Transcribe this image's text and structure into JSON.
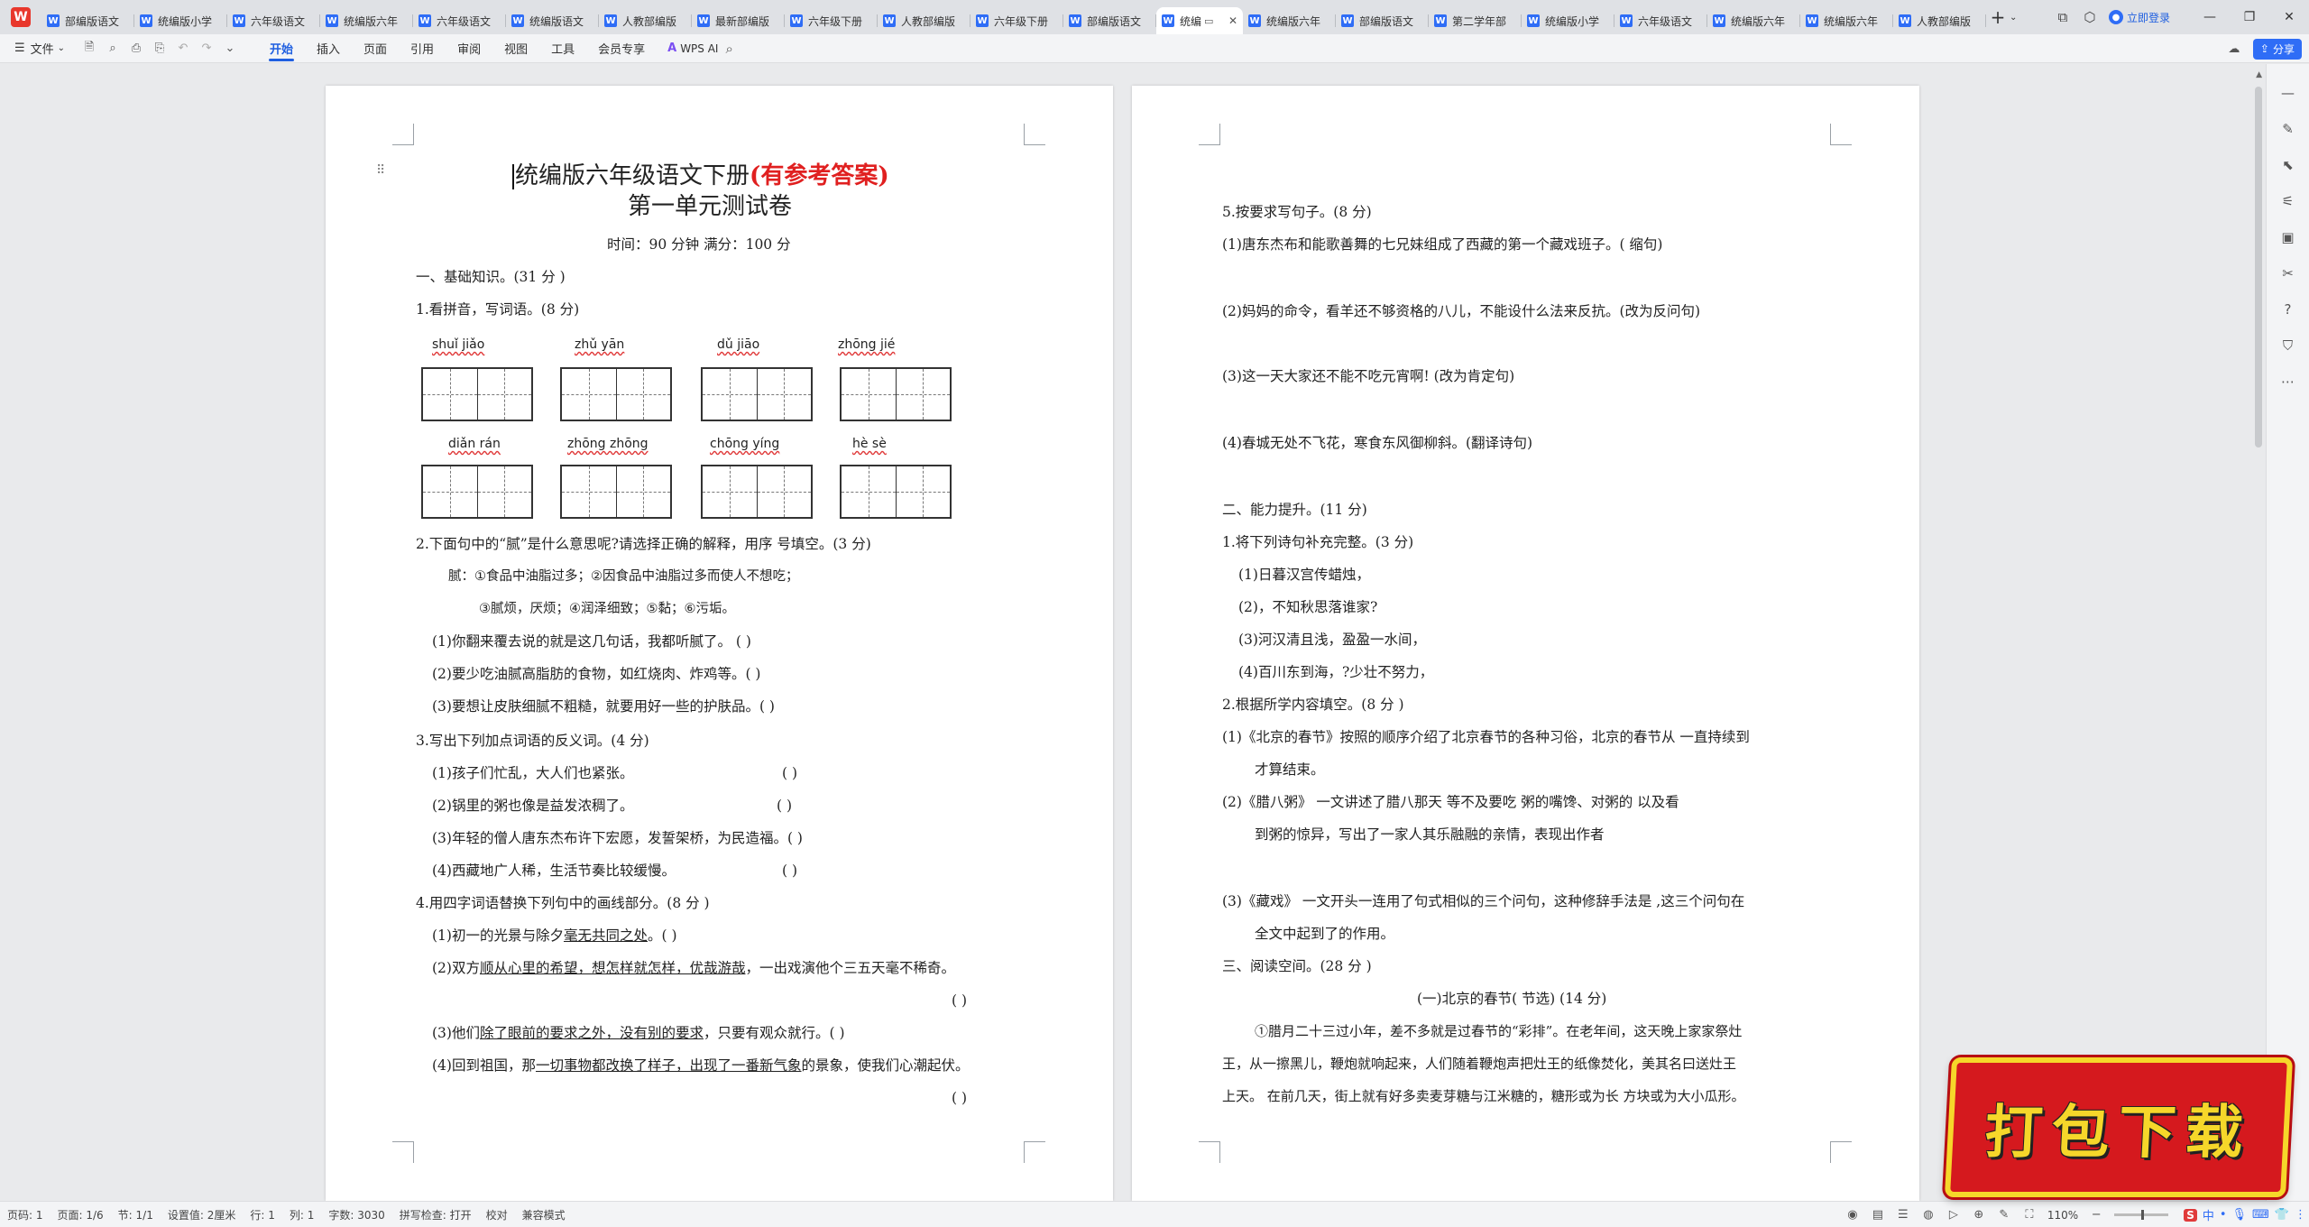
{
  "app": {
    "tabs": [
      {
        "label": "部编版语文",
        "active": false
      },
      {
        "label": "统编版小学",
        "active": false
      },
      {
        "label": "六年级语文",
        "active": false
      },
      {
        "label": "统编版六年",
        "active": false
      },
      {
        "label": "六年级语文",
        "active": false
      },
      {
        "label": "统编版语文",
        "active": false
      },
      {
        "label": "人教部编版",
        "active": false
      },
      {
        "label": "最新部编版",
        "active": false
      },
      {
        "label": "六年级下册",
        "active": false
      },
      {
        "label": "人教部编版",
        "active": false
      },
      {
        "label": "六年级下册",
        "active": false
      },
      {
        "label": "部编版语文",
        "active": false
      },
      {
        "label": "统编",
        "active": true
      },
      {
        "label": "统编版六年",
        "active": false
      },
      {
        "label": "部编版语文",
        "active": false
      },
      {
        "label": "第二学年部",
        "active": false
      },
      {
        "label": "统编版小学",
        "active": false
      },
      {
        "label": "六年级语文",
        "active": false
      },
      {
        "label": "统编版六年",
        "active": false
      },
      {
        "label": "统编版六年",
        "active": false
      },
      {
        "label": "人教部编版",
        "active": false
      }
    ],
    "login_label": "立即登录",
    "share_label": "分享"
  },
  "menubar": {
    "file_label": "文件",
    "tabs": [
      "开始",
      "插入",
      "页面",
      "引用",
      "审阅",
      "视图",
      "工具",
      "会员专享"
    ],
    "active_tab": "开始",
    "ai_label": "WPS AI"
  },
  "page1": {
    "title_main": "统编版六年级语文下册",
    "title_red": "(有参考答案)",
    "subtitle": "第一单元测试卷",
    "meta": "时间：90 分钟    满分：100 分",
    "section1": "一、基础知识。(31 分 )",
    "q1": "1.看拼音，写词语。(8 分)",
    "pinyin_row1": [
      "shuǐ   jiǎo",
      "zhǔ    yān",
      "dǔ   jiāo",
      "zhōng  jié"
    ],
    "pinyin_row2": [
      "diǎn   rán",
      "zhōng  zhōng",
      "chōng  yíng",
      "hè    sè"
    ],
    "q2": "2.下面句中的“腻”是什么意思呢?请选择正确的解释，用序  号填空。(3 分)",
    "q2_def1": "腻：①食品中油脂过多；②因食品中油脂过多而使人不想吃；",
    "q2_def2": "③腻烦，厌烦；④润泽细致；⑤黏；⑥污垢。",
    "q2_items": [
      "(1)你翻来覆去说的就是这几句话，我都听腻了。   (       )",
      "(2)要少吃油腻高脂肪的食物，如红烧肉、炸鸡等。(       )",
      "(3)要想让皮肤细腻不粗糙，就要用好一些的护肤品。(       )"
    ],
    "q3": "3.写出下列加点词语的反义词。(4 分)",
    "q3_items": [
      {
        "text": "(1)孩子们忙乱，大人们也紧张。",
        "blank": "(          )"
      },
      {
        "text": "(2)锅里的粥也像是益发浓稠了。",
        "blank": "(          )"
      },
      {
        "text": "(3)年轻的僧人唐东杰布许下宏愿，发誓架桥，为民造福。(          )",
        "blank": ""
      },
      {
        "text": "(4)西藏地广人稀，生活节奏比较缓慢。",
        "blank": "(          )"
      }
    ],
    "q4": "4.用四字词语替换下列句中的画线部分。(8 分 )",
    "q4_1_pre": "(1)初一的光景与除夕",
    "q4_1_u": "毫无共同之处",
    "q4_1_post": "。(          )",
    "q4_2_pre": "(2)双方",
    "q4_2_u": "顺从心里的希望，想怎样就怎样，优哉游哉",
    "q4_2_post": "，一出戏演他个三五天毫不稀奇。",
    "q4_2_blank": "(          )",
    "q4_3_pre": "(3)他们",
    "q4_3_u": "除了眼前的要求之外，没有别的要求",
    "q4_3_post": "，只要有观众就行。(          )",
    "q4_4_pre": "(4)回到祖国，那",
    "q4_4_u": "一切事物都改换了样子，出现了一番新气象",
    "q4_4_post": "的景象，使我们心潮起伏。",
    "q4_4_blank": "(          )"
  },
  "page2": {
    "q5": "5.按要求写句子。(8 分)",
    "q5_items": [
      "(1)唐东杰布和能歌善舞的七兄妹组成了西藏的第一个藏戏班子。(  缩句)",
      "(2)妈妈的命令，看羊还不够资格的八儿，不能设什么法来反抗。(改为反问句)",
      "(3)这一天大家还不能不吃元宵啊! (改为肯定句)",
      "(4)春城无处不飞花，寒食东风御柳斜。(翻译诗句)"
    ],
    "section2": "二、能力提升。(11 分)",
    "s2_q1": "1.将下列诗句补充完整。(3 分)",
    "s2_q1_items": [
      "(1)日暮汉宫传蜡烛，",
      "(2)，不知秋思落谁家?",
      "(3)河汉清且浅，盈盈一水间，",
      "(4)百川东到海，?少壮不努力，"
    ],
    "s2_q2": "2.根据所学内容填空。(8 分 )",
    "s2_q2_1a": "(1)《北京的春节》按照的顺序介绍了北京春节的各种习俗，北京的春节从  一直持续到",
    "s2_q2_1b": "才算结束。",
    "s2_q2_2a": "(2)《腊八粥》  一文讲述了腊八那天    等不及要吃  粥的嘴馋、对粥的               以及看",
    "s2_q2_2b": "到粥的惊异，写出了一家人其乐融融的亲情，表现出作者",
    "s2_q2_3a": "(3)《藏戏》  一文开头一连用了句式相似的三个问句，这种修辞手法是  ,这三个问句在",
    "s2_q2_3b": "全文中起到了的作用。",
    "section3": "三、阅读空间。(28 分 )",
    "reading_title": "(一)北京的春节(  节选) (14 分)",
    "reading_p1": "①腊月二十三过小年，差不多就是过春节的“彩排”。在老年间，这天晚上家家祭灶",
    "reading_p2": "王，从一擦黑儿，鞭炮就响起来，人们随着鞭炮声把灶王的纸像焚化，美其名曰送灶王",
    "reading_p3": "上天。 在前几天，街上就有好多卖麦芽糖与江米糖的，糖形或为长    方块或为大小瓜形。"
  },
  "statusbar": {
    "page_no": "页码: 1",
    "pages": "页面: 1/6",
    "section": "节: 1/1",
    "position": "设置值: 2厘米",
    "row": "行: 1",
    "col": "列: 1",
    "wordcount": "字数: 3030",
    "spellcheck": "拼写检查: 打开",
    "proofread": "校对",
    "compat": "兼容模式",
    "zoom": "110%"
  },
  "banner": {
    "text": "打包下载"
  },
  "colors": {
    "accent": "#1f5fe0",
    "title_red": "#e02020",
    "banner_red": "#d5191e",
    "banner_yellow": "#f6d72a"
  }
}
